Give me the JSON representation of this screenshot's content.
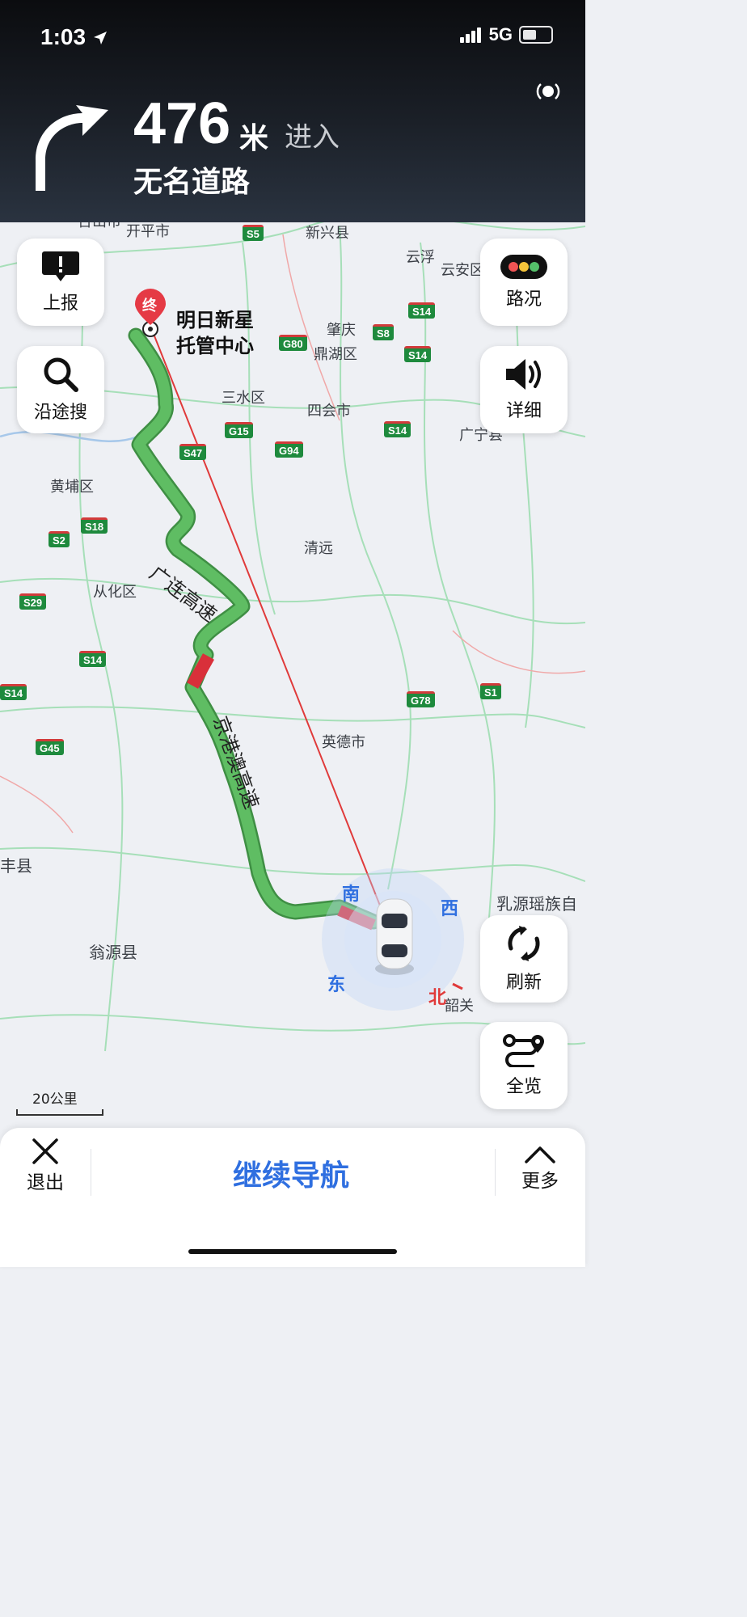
{
  "status_bar": {
    "time": "1:03",
    "network": "5G"
  },
  "navigation": {
    "distance": "476",
    "distance_unit": "米",
    "action": "进入",
    "road_name": "无名道路"
  },
  "buttons": {
    "report": "上报",
    "search_along": "沿途搜",
    "traffic": "路况",
    "detail": "详细",
    "refresh": "刷新",
    "overview": "全览"
  },
  "destination": {
    "marker": "终",
    "line1": "明日新星",
    "line2": "托管中心"
  },
  "route_labels": {
    "highway1": "广连高速",
    "highway2": "京港澳高速"
  },
  "compass": {
    "south": "南",
    "west": "西",
    "east": "东",
    "north": "北"
  },
  "places": [
    "台山市",
    "开平市",
    "新兴县",
    "云浮",
    "云安区",
    "肇庆",
    "鼎湖区",
    "三水区",
    "四会市",
    "广宁县",
    "黄埔区",
    "清远",
    "从化区",
    "英德市",
    "翁源县",
    "乳源瑶族自",
    "韶关",
    "丰县"
  ],
  "road_shields": [
    "S5",
    "G80",
    "S14",
    "S8",
    "S14",
    "G15",
    "S47",
    "G94",
    "S14",
    "S18",
    "S2",
    "S29",
    "S14",
    "G78",
    "S1",
    "G45",
    "S14"
  ],
  "scale": "20公里",
  "bottom_bar": {
    "exit": "退出",
    "continue": "继续导航",
    "more": "更多"
  },
  "colors": {
    "route_green": "#5fbd63",
    "route_red": "#d9303a",
    "accent_blue": "#2f6fe0"
  }
}
